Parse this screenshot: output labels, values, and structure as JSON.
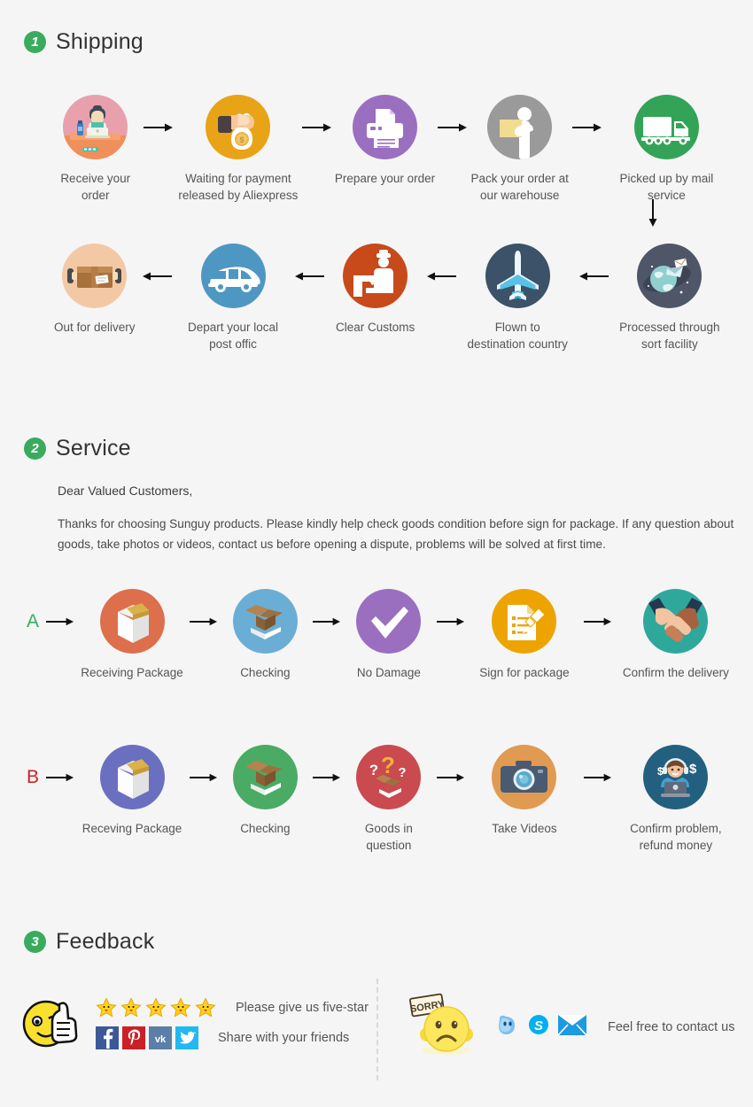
{
  "background": "#f5f5f5",
  "accent_green": "#3aab5e",
  "sections": {
    "shipping": {
      "badge": "1",
      "title": "Shipping",
      "row1": [
        {
          "caption": "Receive your order",
          "icon": "desk-worker-icon",
          "color": "#e8a0ac"
        },
        {
          "caption": "Waiting for payment\nreleased by Aliexpress",
          "icon": "money-bag-hand-icon",
          "color": "#e8a317"
        },
        {
          "caption": "Prepare your order",
          "icon": "printer-icon",
          "color": "#9b6fc0"
        },
        {
          "caption": "Pack your order at\nour warehouse",
          "icon": "warehouse-worker-icon",
          "color": "#9a9a9a"
        },
        {
          "caption": "Picked up by mail service",
          "icon": "truck-icon",
          "color": "#33a457"
        }
      ],
      "row2": [
        {
          "caption": "Out for delivery",
          "icon": "parcel-delivery-icon",
          "color": "#f3c9a5"
        },
        {
          "caption": "Depart your local\npost offic",
          "icon": "delivery-van-icon",
          "color": "#4e97c2"
        },
        {
          "caption": "Clear  Customs",
          "icon": "customs-officer-icon",
          "color": "#c8491a"
        },
        {
          "caption": "Flown to\ndestination country",
          "icon": "airplane-icon",
          "color": "#3b5268"
        },
        {
          "caption": "Processed through\nsort facility",
          "icon": "sort-facility-globe-icon",
          "color": "#4f5668"
        }
      ],
      "down_arrow": "down-arrow-icon"
    },
    "service": {
      "badge": "2",
      "title": "Service",
      "greeting": "Dear Valued Customers,",
      "paragraph": "Thanks for choosing Sunguy products. Please kindly help check goods condition before sign for package. If any question about goods, take photos or videos, contact us before opening a dispute, problems will be solved at first time.",
      "rowA": {
        "label": "A",
        "label_color": "#3aab5e",
        "steps": [
          {
            "caption": "Receiving Package",
            "icon": "sealed-box-icon",
            "color": "#dd6f4c"
          },
          {
            "caption": "Checking",
            "icon": "open-box-icon",
            "color": "#6aaed6"
          },
          {
            "caption": "No Damage",
            "icon": "checkmark-icon",
            "color": "#9b6fc0"
          },
          {
            "caption": "Sign for package",
            "icon": "sign-document-icon",
            "color": "#eda400"
          },
          {
            "caption": "Confirm the delivery",
            "icon": "handshake-icon",
            "color": "#2fa89c"
          }
        ]
      },
      "rowB": {
        "label": "B",
        "label_color": "#d12020",
        "steps": [
          {
            "caption": "Receving Package",
            "icon": "sealed-box-icon",
            "color": "#6a6fc0"
          },
          {
            "caption": "Checking",
            "icon": "open-box-icon",
            "color": "#4aab65"
          },
          {
            "caption": "Goods in question",
            "icon": "question-box-icon",
            "color": "#c94a4f"
          },
          {
            "caption": "Take Videos",
            "icon": "camera-icon",
            "color": "#e09a52"
          },
          {
            "caption": "Confirm problem,\nrefund money",
            "icon": "support-agent-icon",
            "color": "#23607f"
          }
        ]
      }
    },
    "feedback": {
      "badge": "3",
      "title": "Feedback",
      "happy_face": "winking-thumbs-up-face-icon",
      "sad_face": "sorry-sad-face-icon",
      "star_count": 5,
      "star_icon": "star-icon",
      "five_star_text": "Please give us five-star",
      "share_text": "Share with your friends",
      "contact_text": "Feel free to contact us",
      "social": [
        {
          "name": "facebook-icon",
          "glyph": "f",
          "color": "#3b5998"
        },
        {
          "name": "pinterest-icon",
          "glyph": "P",
          "color": "#cb2027"
        },
        {
          "name": "vk-icon",
          "glyph": "vk",
          "color": "#5b7fa6"
        },
        {
          "name": "twitter-icon",
          "glyph": "t",
          "color": "#22b8f0"
        }
      ],
      "contacts": [
        {
          "name": "aliwangwang-icon",
          "color": "#5aa8e0"
        },
        {
          "name": "skype-icon",
          "color": "#00aff0"
        },
        {
          "name": "email-icon",
          "color": "#1e9ae0"
        }
      ]
    }
  }
}
